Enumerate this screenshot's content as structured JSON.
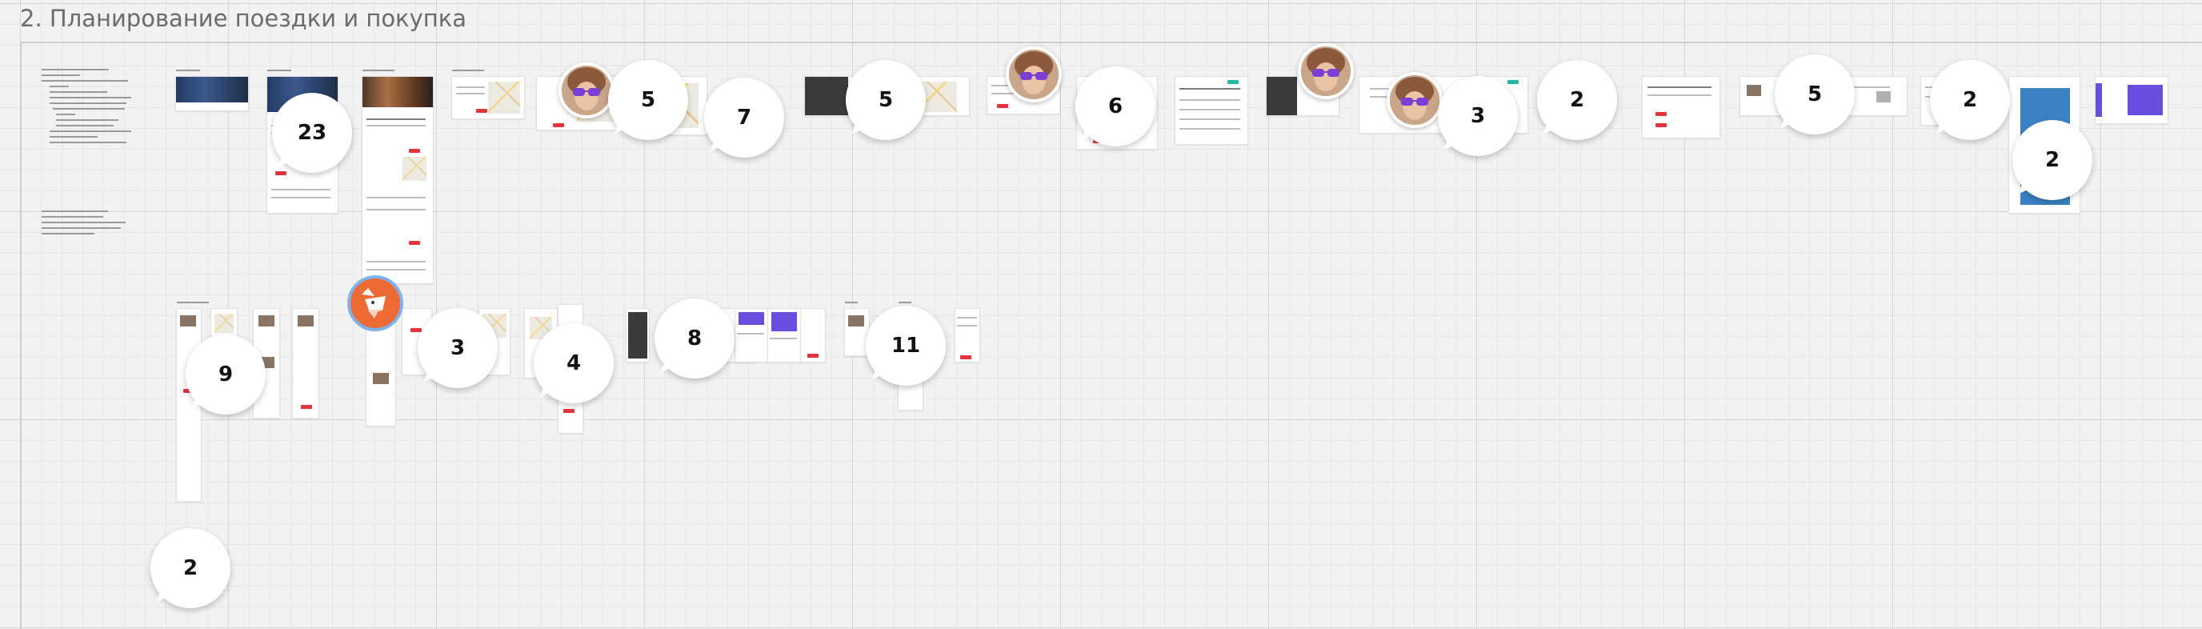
{
  "board": {
    "title": "2. Планирование поездки и покупка"
  },
  "comment_badges": [
    {
      "count": "23"
    },
    {
      "count": "5"
    },
    {
      "count": "7"
    },
    {
      "count": "5"
    },
    {
      "count": "6"
    },
    {
      "count": "3"
    },
    {
      "count": "2"
    },
    {
      "count": "5"
    },
    {
      "count": "2"
    },
    {
      "count": "2"
    },
    {
      "count": "9"
    },
    {
      "count": "3"
    },
    {
      "count": "4"
    },
    {
      "count": "8"
    },
    {
      "count": "11"
    },
    {
      "count": "2"
    }
  ],
  "colors": {
    "grid_major": "#d6d6d6",
    "grid_minor": "#e7e7e7",
    "background": "#f2f2f2",
    "accent_red": "#e3343d",
    "accent_teal": "#1fb8a3",
    "accent_purple": "#6a4ce0",
    "accent_blue": "#3a82c4",
    "fox_orange": "#ed6a34"
  },
  "icons": {
    "collaborator_avatar": "avatar-sunglasses-icon",
    "guest_avatar": "fox-icon",
    "comment": "comment-bubble-icon"
  }
}
